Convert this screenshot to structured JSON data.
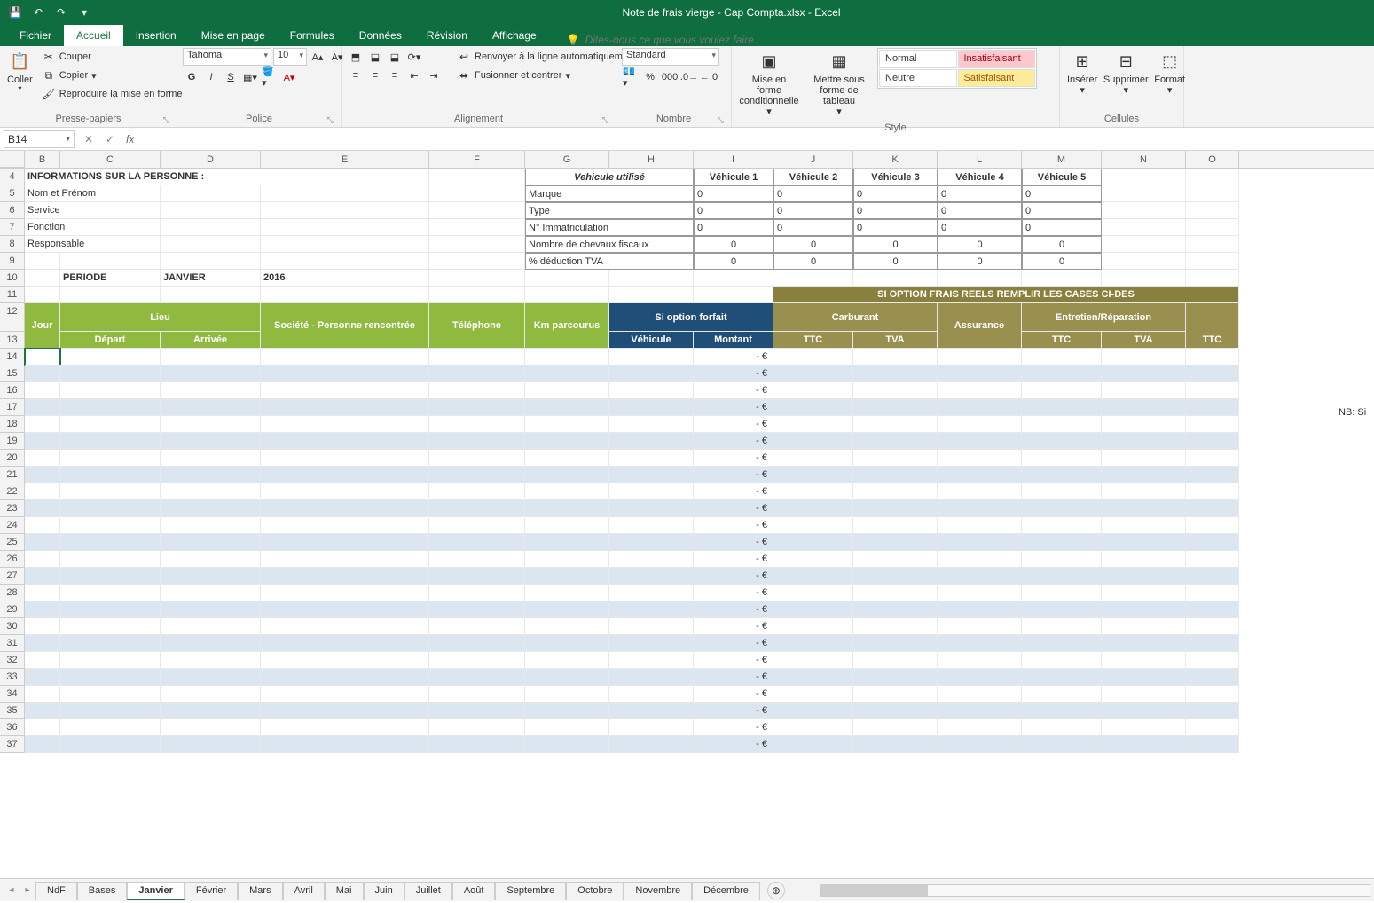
{
  "title": "Note de frais vierge - Cap Compta.xlsx - Excel",
  "qat": {
    "save": "💾",
    "undo": "↶",
    "redo": "↷"
  },
  "tabs": [
    "Fichier",
    "Accueil",
    "Insertion",
    "Mise en page",
    "Formules",
    "Données",
    "Révision",
    "Affichage"
  ],
  "tellme_placeholder": "Dites-nous ce que vous voulez faire..",
  "ribbon": {
    "clipboard": {
      "label": "Presse-papiers",
      "paste": "Coller",
      "cut": "Couper",
      "copy": "Copier",
      "painter": "Reproduire la mise en forme"
    },
    "font": {
      "label": "Police",
      "name": "Tahoma",
      "size": "10"
    },
    "alignment": {
      "label": "Alignement",
      "wrap": "Renvoyer à la ligne automatiquement",
      "merge": "Fusionner et centrer"
    },
    "number": {
      "label": "Nombre",
      "format": "Standard"
    },
    "styles": {
      "label": "Style",
      "cond": "Mise en forme conditionnelle",
      "table": "Mettre sous forme de tableau",
      "normal": "Normal",
      "bad": "Insatisfaisant",
      "neutral": "Neutre",
      "good": "Satisfaisant"
    },
    "cells": {
      "label": "Cellules",
      "insert": "Insérer",
      "delete": "Supprimer",
      "format": "Format"
    }
  },
  "namebox": "B14",
  "info_header": "INFORMATIONS SUR LA PERSONNE :",
  "info_rows": [
    "Nom et Prénom",
    "Service",
    "Fonction",
    "Responsable"
  ],
  "periode_label": "PERIODE",
  "periode_month": "JANVIER",
  "periode_year": "2016",
  "vehicule_title": "Vehicule utilisé",
  "vehicule_cols": [
    "Véhicule 1",
    "Véhicule 2",
    "Véhicule 3",
    "Véhicule 4",
    "Véhicule 5"
  ],
  "vehicule_rows": [
    "Marque",
    "Type",
    "N° Immatriculation",
    "Nombre de chevaux fiscaux",
    "% déduction TVA"
  ],
  "vehicule_zeros": [
    [
      "0",
      "0",
      "0",
      "0",
      "0"
    ],
    [
      "0",
      "0",
      "0",
      "0",
      "0"
    ],
    [
      "0",
      "0",
      "0",
      "0",
      "0"
    ],
    [
      "0",
      "0",
      "0",
      "0",
      "0"
    ],
    [
      "0",
      "0",
      "0",
      "0",
      "0"
    ]
  ],
  "nb_note": "NB: Si",
  "band_olive": "SI OPTION FRAIS REELS REMPLIR LES CASES CI-DES",
  "headers": {
    "jour": "Jour",
    "lieu": "Lieu",
    "depart": "Départ",
    "arrivee": "Arrivée",
    "societe": "Société - Personne rencontrée",
    "telephone": "Téléphone",
    "km": "Km parcourus",
    "option": "Si option forfait",
    "vehicule": "Véhicule",
    "montant": "Montant",
    "carburant": "Carburant",
    "assurance": "Assurance",
    "entretien": "Entretien/Réparation",
    "ttc": "TTC",
    "tva": "TVA"
  },
  "montant_display": "-     €",
  "data_row_count": 24,
  "cols": [
    "B",
    "C",
    "D",
    "E",
    "F",
    "G",
    "H",
    "I",
    "J",
    "K",
    "L",
    "M",
    "N",
    "O"
  ],
  "sheet_tabs": [
    "NdF",
    "Bases",
    "Janvier",
    "Février",
    "Mars",
    "Avril",
    "Mai",
    "Juin",
    "Juillet",
    "Août",
    "Septembre",
    "Octobre",
    "Novembre",
    "Décembre"
  ],
  "active_sheet": "Janvier"
}
